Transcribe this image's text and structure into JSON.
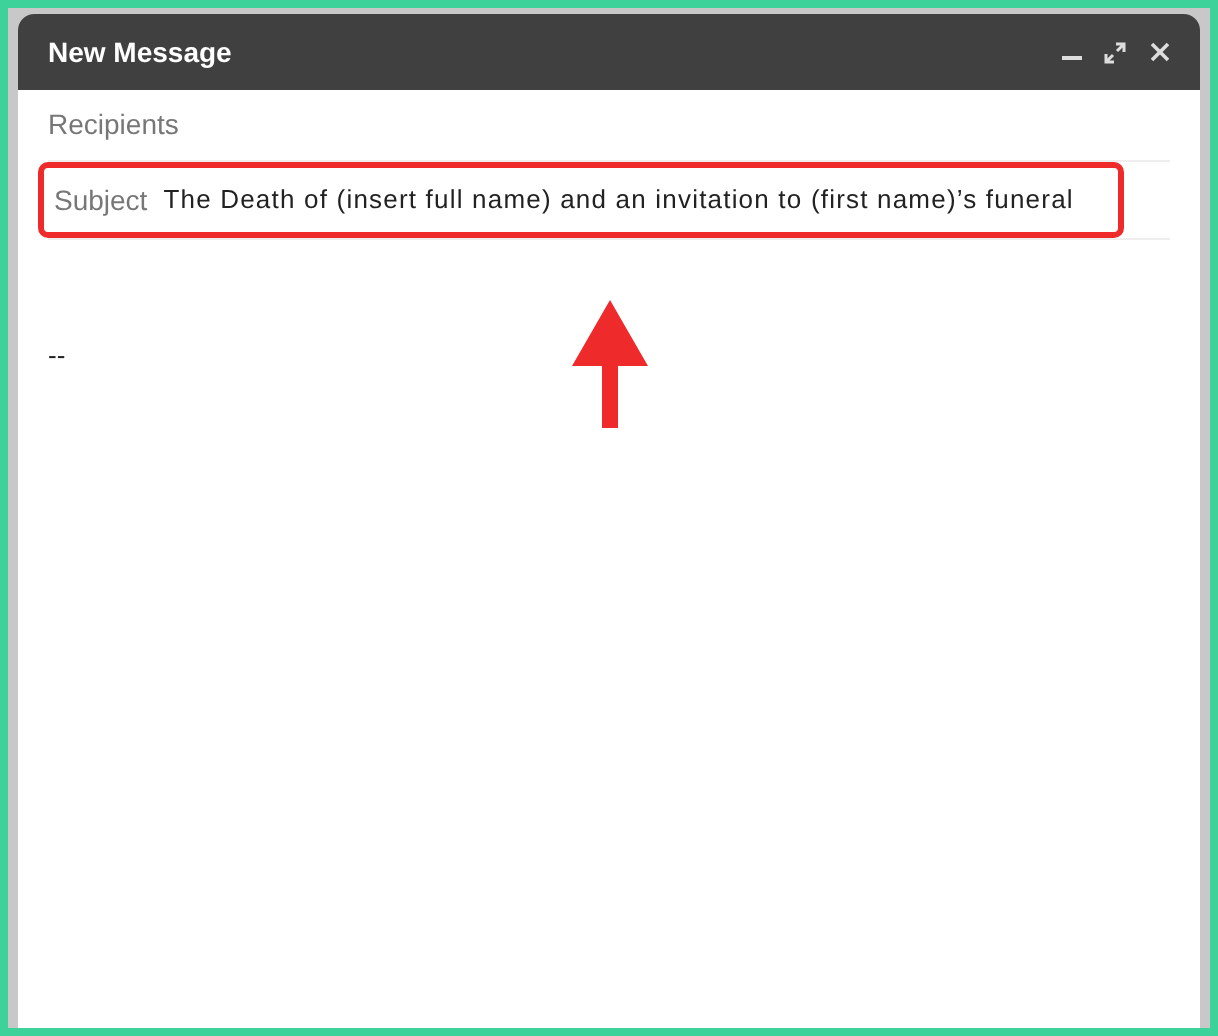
{
  "window": {
    "title": "New Message"
  },
  "recipients": {
    "placeholder": "Recipients"
  },
  "subject": {
    "label": "Subject",
    "value": "The Death of (insert full name) and an invitation to (first name)’s funeral",
    "highlighted": true
  },
  "body": {
    "signature": "--"
  }
}
